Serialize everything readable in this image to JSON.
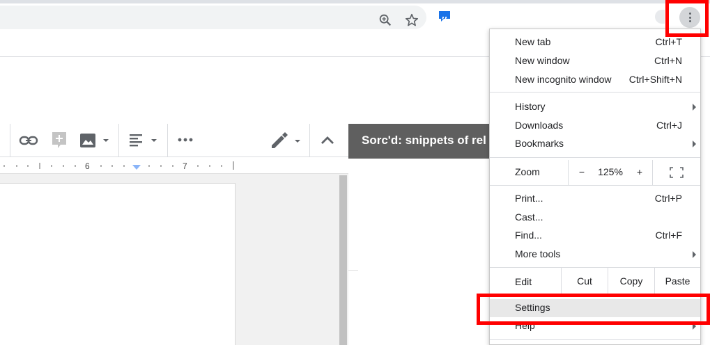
{
  "browser": {
    "toolbar_icons": [
      "zoom-in-icon",
      "star-icon",
      "quotes-extension-icon",
      "more-vert-icon"
    ]
  },
  "doc_toolbar": {
    "icons": [
      "link-icon",
      "comment-icon",
      "image-icon",
      "align-icon",
      "more-horiz-icon",
      "edit-pencil-icon",
      "collapse-icon"
    ]
  },
  "ruler": {
    "marks": [
      "6",
      "7"
    ]
  },
  "side_panel": {
    "title": "Sorc'd: snippets of rel"
  },
  "chrome_menu": {
    "new_tab": {
      "label": "New tab",
      "shortcut": "Ctrl+T"
    },
    "new_window": {
      "label": "New window",
      "shortcut": "Ctrl+N"
    },
    "new_incognito": {
      "label": "New incognito window",
      "shortcut": "Ctrl+Shift+N"
    },
    "history": {
      "label": "History"
    },
    "downloads": {
      "label": "Downloads",
      "shortcut": "Ctrl+J"
    },
    "bookmarks": {
      "label": "Bookmarks"
    },
    "zoom": {
      "label": "Zoom",
      "minus": "−",
      "value": "125%",
      "plus": "+"
    },
    "print": {
      "label": "Print...",
      "shortcut": "Ctrl+P"
    },
    "cast": {
      "label": "Cast..."
    },
    "find": {
      "label": "Find...",
      "shortcut": "Ctrl+F"
    },
    "more_tools": {
      "label": "More tools"
    },
    "edit": {
      "label": "Edit",
      "cut": "Cut",
      "copy": "Copy",
      "paste": "Paste"
    },
    "settings": {
      "label": "Settings"
    },
    "help": {
      "label": "Help"
    }
  },
  "highlight_color": "#ff0000"
}
